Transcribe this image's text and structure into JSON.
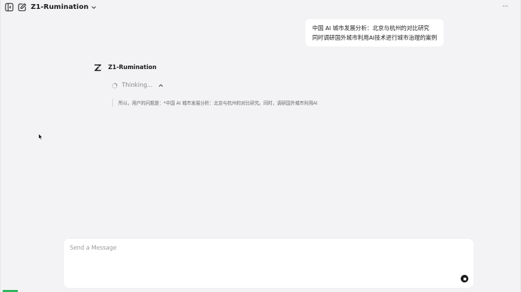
{
  "header": {
    "model_name": "Z1-Rumination",
    "more_label": "···"
  },
  "conversation": {
    "user_message_lines": [
      "中国 AI 城市发展分析：北京与杭州的对比研究",
      "同时调研国外城市利用AI技术进行城市治理的案例"
    ],
    "assistant": {
      "name": "Z1-Rumination",
      "thinking_label": "Thinking...",
      "thought_text": "所以，用户的问题是：*中国 AI 城市发展分析：北京与杭州的对比研究。同时，调研国外城市利用AI"
    }
  },
  "composer": {
    "placeholder": "Send a Message",
    "value": ""
  },
  "colors": {
    "background": "#f3f3f5",
    "surface": "#ffffff",
    "text_primary": "#1a1a1a",
    "text_muted": "#8a8a8a",
    "accent": "#2db55d"
  },
  "icons": {
    "sidebar_toggle": "sidebar-toggle-icon",
    "new_chat": "edit-icon",
    "model_dropdown": "chevron-down-icon",
    "more": "more-icon",
    "logo": "z-logo-icon",
    "thinking": "spinner-icon",
    "thinking_toggle": "chevron-up-icon",
    "stop": "stop-icon"
  }
}
